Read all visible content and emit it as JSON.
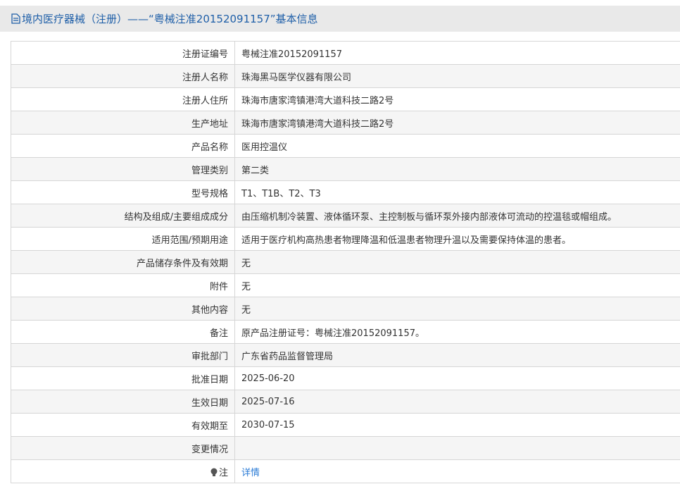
{
  "title": "境内医疗器械（注册）——“粤械注准20152091157”基本信息",
  "rows": [
    {
      "label": "注册证编号",
      "value": "粤械注准20152091157"
    },
    {
      "label": "注册人名称",
      "value": "珠海黑马医学仪器有限公司"
    },
    {
      "label": "注册人住所",
      "value": "珠海市唐家湾镇港湾大道科技二路2号"
    },
    {
      "label": "生产地址",
      "value": "珠海市唐家湾镇港湾大道科技二路2号"
    },
    {
      "label": "产品名称",
      "value": "医用控温仪"
    },
    {
      "label": "管理类别",
      "value": "第二类"
    },
    {
      "label": "型号规格",
      "value": "T1、T1B、T2、T3"
    },
    {
      "label": "结构及组成/主要组成成分",
      "value": "由压缩机制冷装置、液体循环泵、主控制板与循环泵外接内部液体可流动的控温毯或帽组成。"
    },
    {
      "label": "适用范围/预期用途",
      "value": "适用于医疗机构高热患者物理降温和低温患者物理升温以及需要保持体温的患者。"
    },
    {
      "label": "产品储存条件及有效期",
      "value": "无"
    },
    {
      "label": "附件",
      "value": "无"
    },
    {
      "label": "其他内容",
      "value": "无"
    },
    {
      "label": "备注",
      "value": "原产品注册证号：粤械注准20152091157。"
    },
    {
      "label": "审批部门",
      "value": "广东省药品监督管理局"
    },
    {
      "label": "批准日期",
      "value": "2025-06-20"
    },
    {
      "label": "生效日期",
      "value": "2025-07-16"
    },
    {
      "label": "有效期至",
      "value": "2030-07-15"
    },
    {
      "label": "变更情况",
      "value": ""
    }
  ],
  "note": {
    "label": "注",
    "link": "详情"
  }
}
